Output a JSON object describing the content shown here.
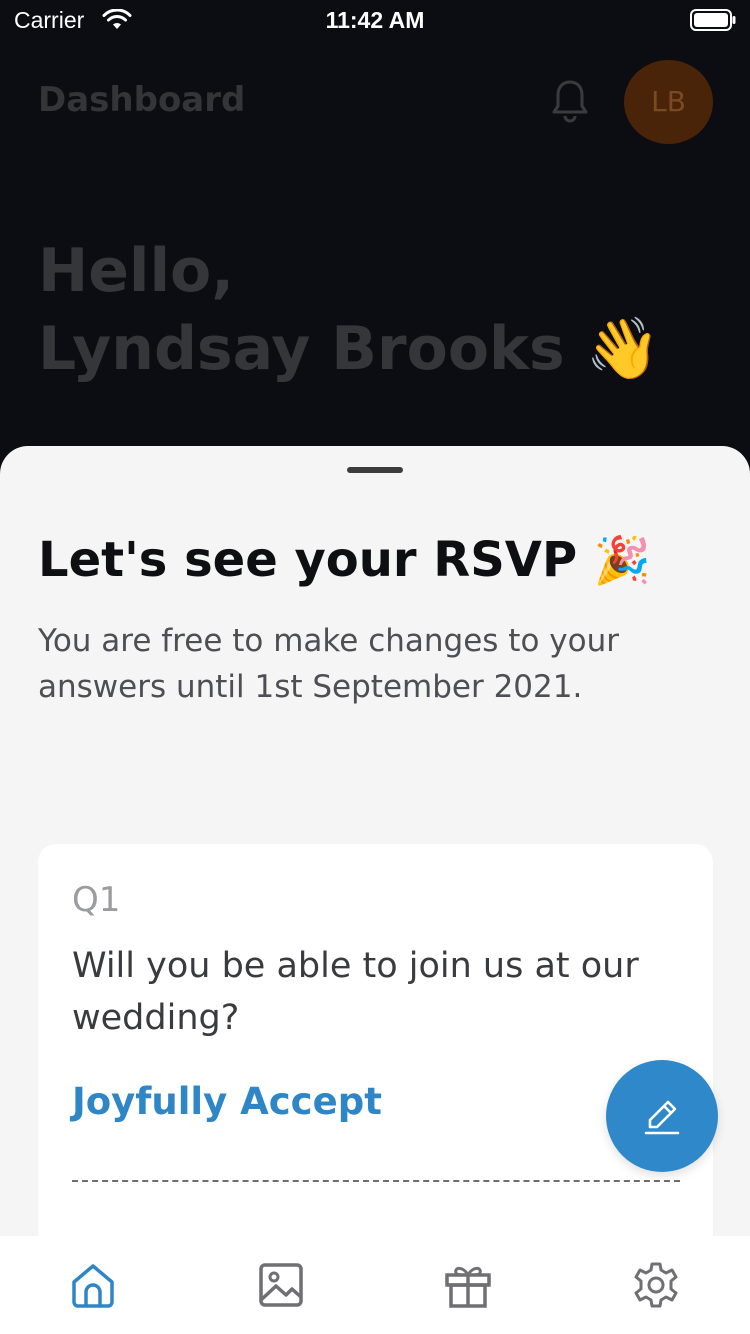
{
  "status_bar": {
    "carrier": "Carrier",
    "time": "11:42 AM",
    "icons": [
      "wifi-icon",
      "battery-icon"
    ]
  },
  "header": {
    "title": "Dashboard",
    "notification_icon": "bell-icon",
    "avatar_initials": "LB"
  },
  "greeting": {
    "line1": "Hello,",
    "line2": "Lyndsay Brooks",
    "emoji": "👋"
  },
  "sheet": {
    "title": "Let's see your RSVP",
    "title_emoji": "🎉",
    "subtitle": "You are free to make changes to your answers until 1st September 2021."
  },
  "question": {
    "number": "Q1",
    "text": "Will you be able to join us at our wedding?",
    "answer": "Joyfully Accept"
  },
  "fab": {
    "icon": "pencil-icon"
  },
  "tabbar": {
    "items": [
      {
        "icon": "home-icon",
        "active": true
      },
      {
        "icon": "image-icon",
        "active": false
      },
      {
        "icon": "gift-icon",
        "active": false
      },
      {
        "icon": "gear-icon",
        "active": false
      }
    ]
  },
  "colors": {
    "accent": "#2f86c7",
    "backdrop": "#0b0d12",
    "sheet": "#f5f5f6",
    "inactive_icon": "#6f6f74"
  }
}
